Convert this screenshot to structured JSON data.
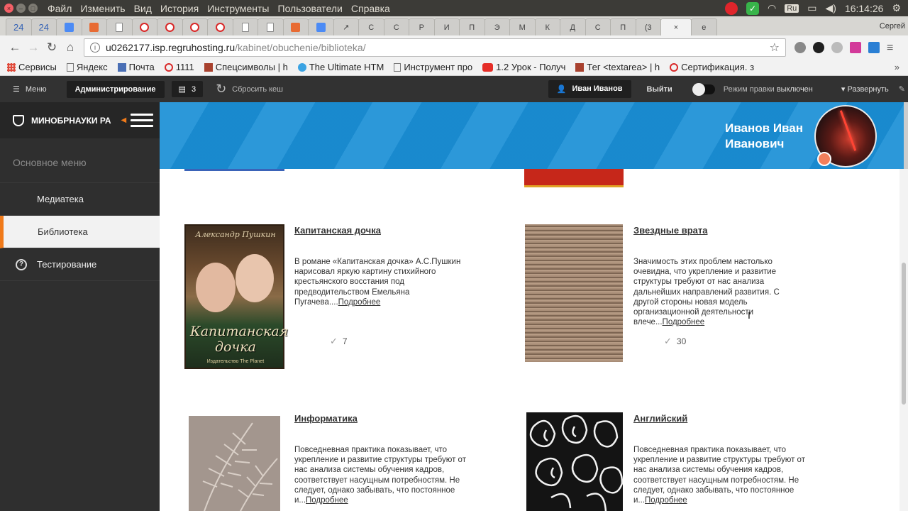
{
  "os": {
    "menu": [
      "Файл",
      "Изменить",
      "Вид",
      "История",
      "Инструменты",
      "Пользователи",
      "Справка"
    ],
    "keyboard": "Ru",
    "time": "16:14:26"
  },
  "tabs": {
    "counts": [
      "24",
      "24"
    ],
    "user": "Сергей",
    "labels": [
      "С",
      "Р",
      "И",
      "П",
      "Э",
      "М",
      "К",
      "Д",
      "С",
      "П",
      "(3",
      "е"
    ]
  },
  "address": {
    "host": "u0262177.isp.regruhosting.ru",
    "path": "/kabinet/obuchenie/biblioteka/"
  },
  "bookmarks": {
    "items": [
      "Сервисы",
      "Яндекс",
      "Почта",
      "1111",
      "Спецсимволы | h",
      "The Ultimate HTM",
      "Инструмент про",
      "1.2 Урок - Получ",
      "Тег <textarea> | h",
      "Сертификация. з"
    ],
    "more": "»"
  },
  "admin": {
    "menu_label": "Меню",
    "admin_label": "Администрирование",
    "badge_count": "3",
    "cache_label": "Сбросить кеш",
    "user_label": "Иван Иванов",
    "logout_label": "Выйти",
    "edit_mode_label": "Режим правки",
    "edit_mode_state": "выключен",
    "expand_label": "Развернуть"
  },
  "sidebar": {
    "brand": "МИНОБРНАУКИ РА",
    "section_title": "Основное меню",
    "items": [
      {
        "label": "Медиатека"
      },
      {
        "label": "Библиотека"
      },
      {
        "label": "Тестирование"
      }
    ]
  },
  "header": {
    "name_line1": "Иванов Иван",
    "name_line2": "Иванович"
  },
  "books": [
    {
      "title": "Капитанская дочка",
      "desc": "В романе «Капитанская дочка» А.С.Пушкин нарисовал яркую картину стихийного крестьянского восстания под предводительством Емельяна Пугачева....",
      "more": "Подробнее",
      "count": "7",
      "cover_author": "Александр Пушкин",
      "cover_title": "Капитанская дочка",
      "cover_publisher": "Издательство The Planet"
    },
    {
      "title": "Звездные врата",
      "desc": "Значимость этих проблем настолько очевидна, что укрепление и развитие структуры требуют от нас анализа дальнейших направлений развития. С другой стороны новая модель организационной деятельности влече...",
      "more": "Подробнее",
      "count": "30"
    },
    {
      "title": "Информатика",
      "desc": "Повседневная практика показывает, что укрепление и развитие структуры требуют от нас анализа системы обучения кадров, соответствует насущным потребностям. Не следует, однако забывать, что постоянное и...",
      "more": "Подробнее"
    },
    {
      "title": "Английский",
      "desc": "Повседневная практика показывает, что укрепление и развитие структуры требуют от нас анализа системы обучения кадров, соответствует насущным потребностям. Не следует, однако забывать, что постоянное и...",
      "more": "Подробнее"
    }
  ],
  "colors": {
    "accent": "#f07a1a",
    "header_blue": "#1a8fd6",
    "sidebar_bg": "#2f2f2f",
    "admin_bar": "#323232"
  }
}
